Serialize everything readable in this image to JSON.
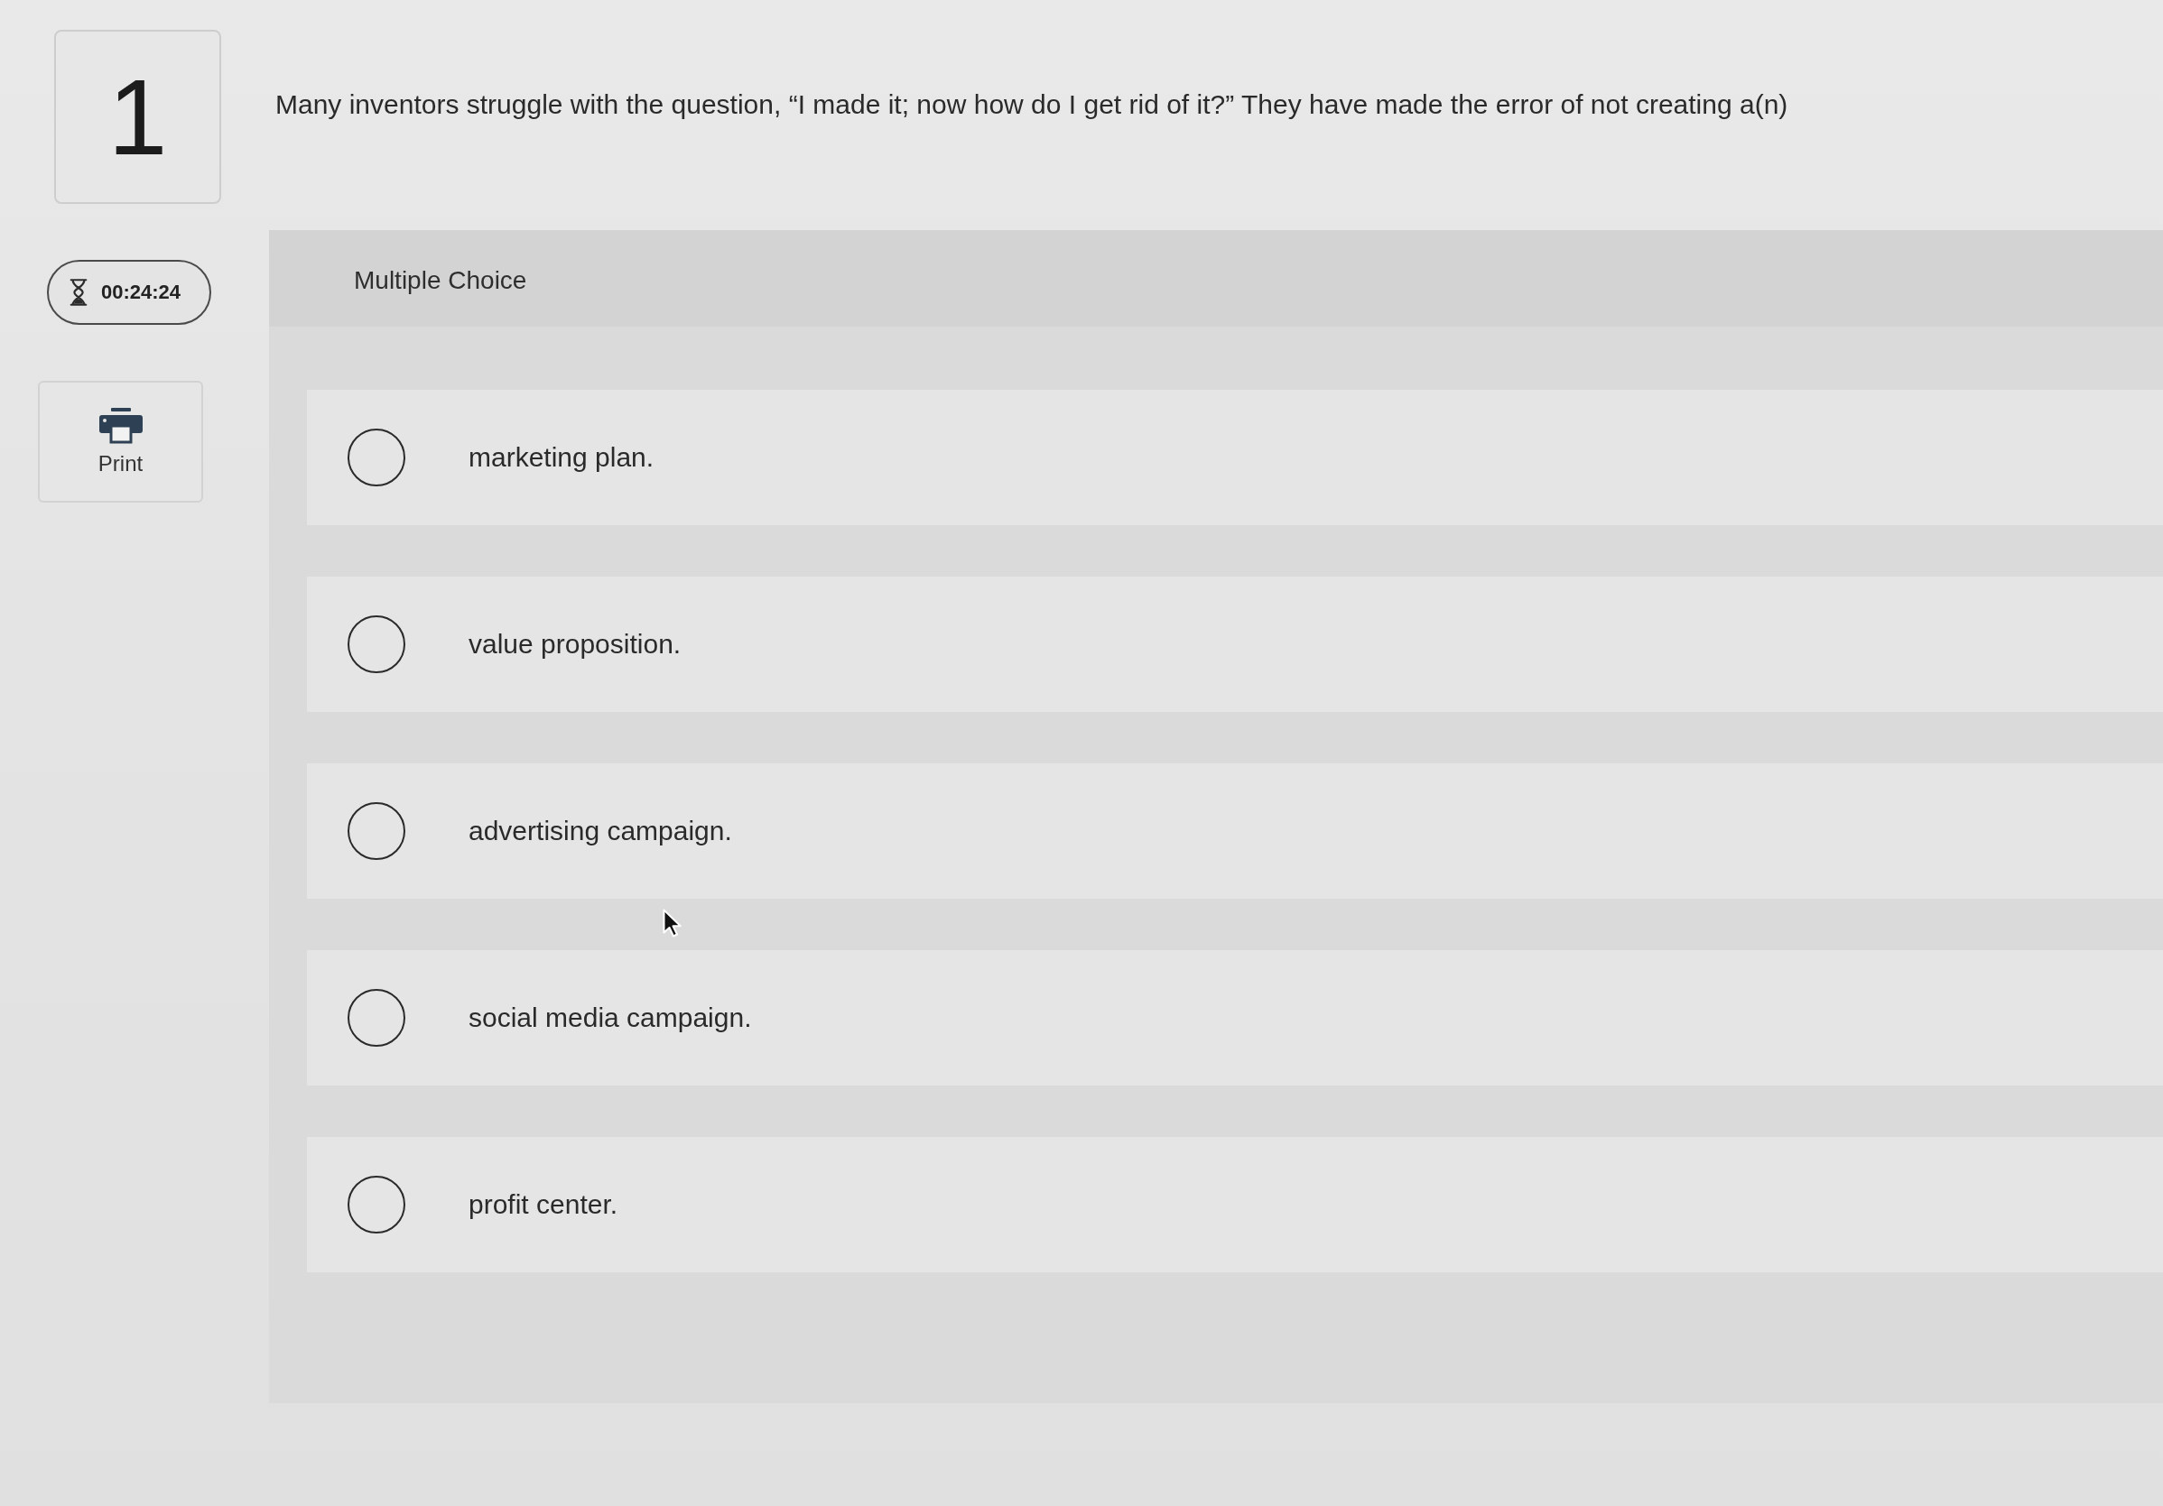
{
  "question": {
    "number": "1",
    "text": "Many inventors struggle with the question, “I made it; now how do I get rid of it?” They have made the error of not creating a(n)"
  },
  "timer": {
    "time": "00:24:24"
  },
  "print_button": {
    "label": "Print"
  },
  "answer_panel": {
    "type_label": "Multiple Choice",
    "options": [
      {
        "text": "marketing plan.",
        "selected": false
      },
      {
        "text": "value proposition.",
        "selected": false
      },
      {
        "text": "advertising campaign.",
        "selected": false
      },
      {
        "text": "social media campaign.",
        "selected": false
      },
      {
        "text": "profit center.",
        "selected": false
      }
    ]
  }
}
